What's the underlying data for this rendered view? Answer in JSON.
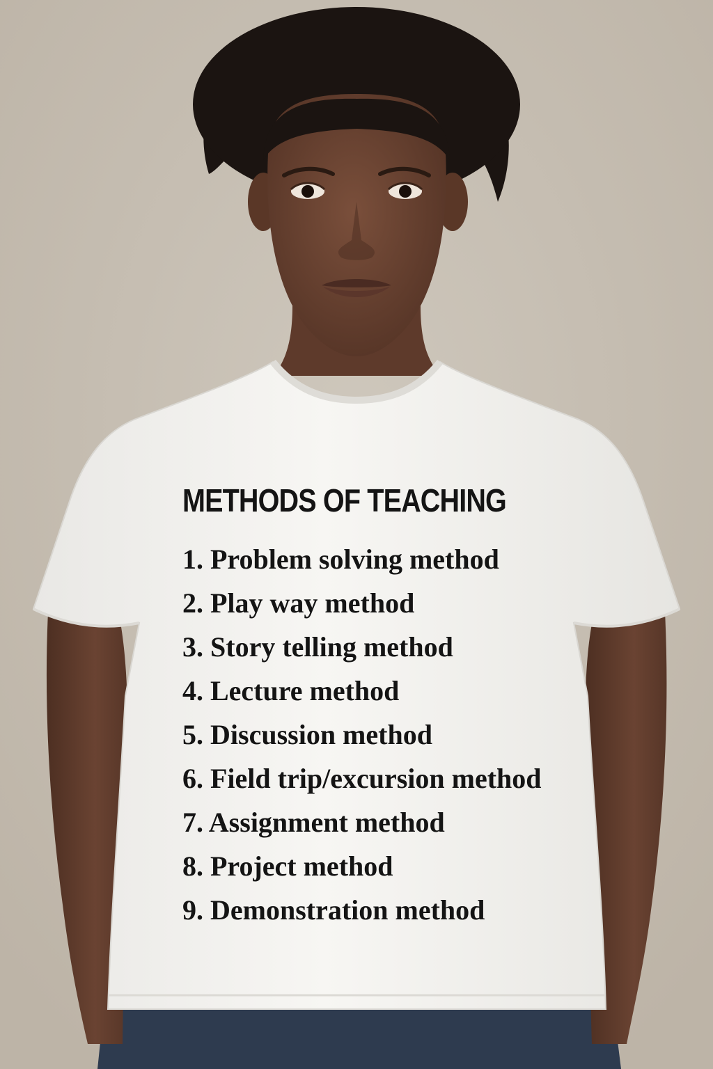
{
  "photo": {
    "subject": "woman-wearing-white-tshirt",
    "colors": {
      "background": "#c6beb2",
      "shirt": "#f4f3f0",
      "skin": "#6b4432",
      "hair": "#1b1411",
      "jeans": "#2e3b4f",
      "print_ink": "#141414"
    }
  },
  "shirt_print": {
    "title": "METHODS OF TEACHING",
    "items": [
      "1. Problem solving method",
      "2. Play way method",
      "3. Story telling method",
      "4. Lecture method",
      "5. Discussion method",
      "6. Field trip/excursion method",
      "7. Assignment method",
      "8. Project method",
      "9. Demonstration method"
    ]
  }
}
